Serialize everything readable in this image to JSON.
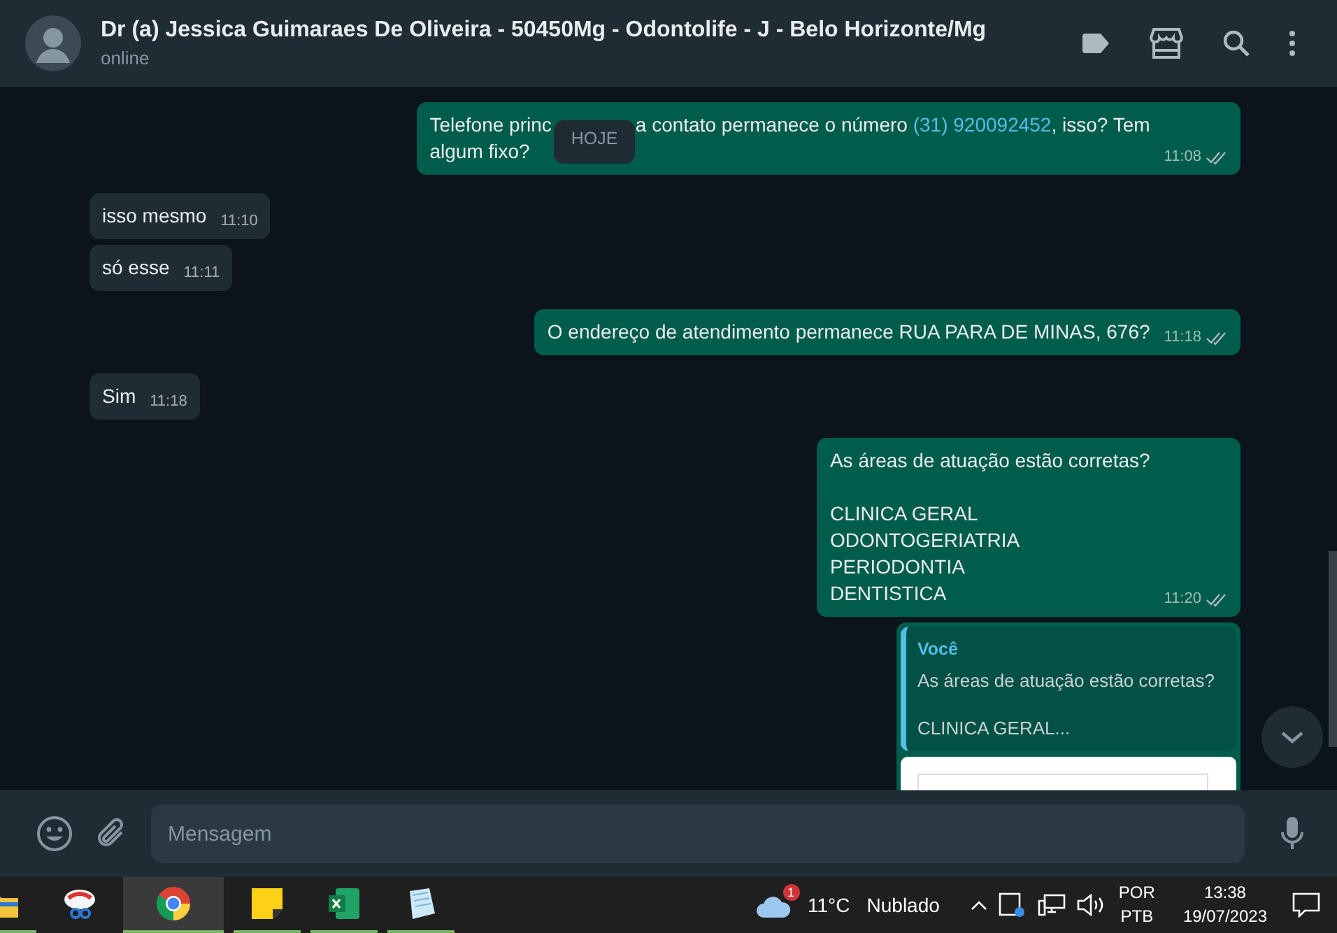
{
  "header": {
    "title": "Dr (a) Jessica Guimaraes De Oliveira - 50450Mg - Odontolife - J - Belo Horizonte/Mg",
    "status": "online"
  },
  "date_badge": "HOJE",
  "messages": [
    {
      "kind": "out",
      "segments": [
        {
          "kind": "text",
          "text": "Telefone princ"
        },
        {
          "kind": "covered"
        },
        {
          "kind": "text",
          "text": "a contato permanece o número "
        },
        {
          "kind": "link",
          "text": "(31) 920092452"
        },
        {
          "kind": "text",
          "text": ", isso? Tem"
        },
        {
          "kind": "break"
        },
        {
          "kind": "text",
          "text": "algum fixo?"
        }
      ],
      "time": "11:08",
      "read": true
    },
    {
      "kind": "in",
      "text": "isso mesmo",
      "time": "11:10"
    },
    {
      "kind": "in",
      "text": "só esse",
      "time": "11:11"
    },
    {
      "kind": "out",
      "text": "O endereço de atendimento permanece RUA PARA DE MINAS, 676?",
      "time": "11:18",
      "read": true
    },
    {
      "kind": "in",
      "text": "Sim",
      "time": "11:18"
    },
    {
      "kind": "out",
      "text": "As áreas de atuação estão corretas?\n\nCLINICA GERAL\nODONTOGERIATRIA\nPERIODONTIA\nDENTISTICA",
      "time": "11:20",
      "read": true
    },
    {
      "kind": "reply",
      "quote_author": "Você",
      "quote_text": "As áreas de atuação estão corretas?\n\nCLINICA GERAL..."
    }
  ],
  "composer": {
    "placeholder": "Mensagem"
  },
  "taskbar": {
    "apps": [
      {
        "kind": "folder",
        "running": true,
        "selected": false
      },
      {
        "kind": "snip",
        "running": false,
        "selected": false
      },
      {
        "kind": "chrome",
        "running": true,
        "selected": true
      },
      {
        "kind": "notes",
        "running": true,
        "selected": false
      },
      {
        "kind": "excel",
        "running": true,
        "selected": false
      },
      {
        "kind": "paper",
        "running": true,
        "selected": false
      }
    ],
    "weather_badge": "1",
    "temperature": "11°C",
    "weather": "Nublado",
    "lang_top": "POR",
    "lang_bottom": "PTB",
    "time": "13:38",
    "date": "19/07/2023"
  }
}
